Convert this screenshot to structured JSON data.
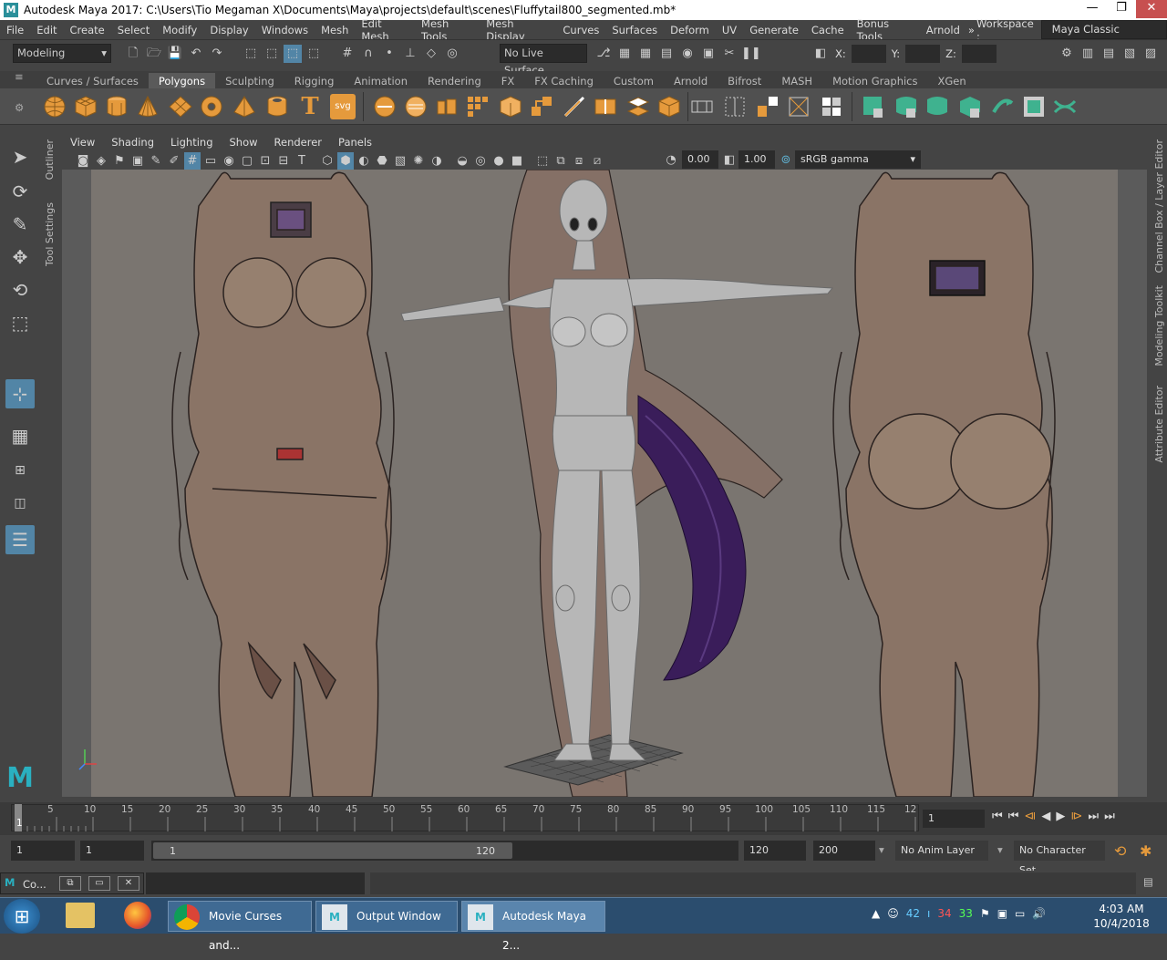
{
  "window": {
    "title": "Autodesk Maya 2017: C:\\Users\\Tio Megaman X\\Documents\\Maya\\projects\\default\\scenes\\Fluffytail800_segmented.mb*",
    "minimize": "—",
    "maximize": "❐",
    "close": "✕"
  },
  "menu": [
    "File",
    "Edit",
    "Create",
    "Select",
    "Modify",
    "Display",
    "Windows",
    "Mesh",
    "Edit Mesh",
    "Mesh Tools",
    "Mesh Display",
    "Curves",
    "Surfaces",
    "Deform",
    "UV",
    "Generate",
    "Cache",
    "Bonus Tools",
    "Arnold"
  ],
  "workspace": {
    "label": "Workspace :",
    "value": "Maya Classic"
  },
  "status": {
    "menuset": "Modeling",
    "live_surface": "No Live Surface",
    "x_label": "X:",
    "y_label": "Y:",
    "z_label": "Z:"
  },
  "shelf_tabs": [
    "Curves / Surfaces",
    "Polygons",
    "Sculpting",
    "Rigging",
    "Animation",
    "Rendering",
    "FX",
    "FX Caching",
    "Custom",
    "Arnold",
    "Bifrost",
    "MASH",
    "Motion Graphics",
    "XGen"
  ],
  "shelf_active": "Polygons",
  "shelf_text_icons": {
    "type": "T",
    "svg": "svg"
  },
  "side_tabs": {
    "outliner": "Outliner",
    "tool_settings": "Tool Settings",
    "channel_box": "Channel Box / Layer Editor",
    "modeling_toolkit": "Modeling Toolkit",
    "attribute_editor": "Attribute Editor"
  },
  "panel_menu": [
    "View",
    "Shading",
    "Lighting",
    "Show",
    "Renderer",
    "Panels"
  ],
  "panel_toolbar": {
    "exposure": "0.00",
    "gamma": "1.00",
    "colorspace": "sRGB gamma"
  },
  "timeline": {
    "ticks": [
      "5",
      "10",
      "15",
      "20",
      "25",
      "30",
      "35",
      "40",
      "45",
      "50",
      "55",
      "60",
      "65",
      "70",
      "75",
      "80",
      "85",
      "90",
      "95",
      "100",
      "105",
      "110",
      "115",
      "12"
    ],
    "current_marker": "1",
    "current_frame": "1"
  },
  "range": {
    "start": "1",
    "anim_start": "1",
    "slider_start": "1",
    "slider_end": "120",
    "range_end": "120",
    "anim_end": "200",
    "anim_layer": "No Anim Layer",
    "char_set": "No Character Set"
  },
  "cmdline": {
    "label": "Co..."
  },
  "taskbar": {
    "items": [
      "Movie Curses and...",
      "Output Window",
      "Autodesk Maya 2..."
    ],
    "time": "4:03 AM",
    "date": "10/4/2018",
    "tray_nums": [
      "42",
      "34",
      "33"
    ]
  },
  "colors": {
    "accent": "#5285a6",
    "shelf_orange": "#e59a3c",
    "shelf_green": "#3fb28f",
    "tail": "#3a1d5a"
  }
}
